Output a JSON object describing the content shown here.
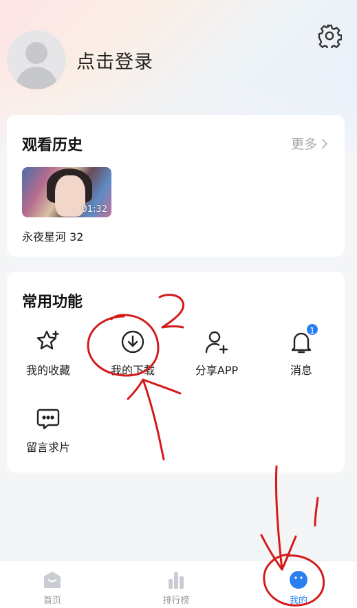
{
  "header": {
    "login_label": "点击登录"
  },
  "history": {
    "title": "观看历史",
    "more_label": "更多",
    "items": [
      {
        "caption": "永夜星河 32",
        "duration": "01:32"
      }
    ]
  },
  "functions": {
    "title": "常用功能",
    "items": [
      {
        "label": "我的收藏",
        "icon": "star-plus-icon"
      },
      {
        "label": "我的下载",
        "icon": "download-icon"
      },
      {
        "label": "分享APP",
        "icon": "user-plus-icon"
      },
      {
        "label": "消息",
        "icon": "bell-icon",
        "badge": "1"
      },
      {
        "label": "留言求片",
        "icon": "chat-bubble-icon"
      }
    ]
  },
  "tabbar": {
    "items": [
      {
        "label": "首页",
        "icon": "home-icon",
        "active": false
      },
      {
        "label": "排行榜",
        "icon": "ranking-icon",
        "active": false
      },
      {
        "label": "我的",
        "icon": "smiley-profile-icon",
        "active": true
      }
    ]
  },
  "colors": {
    "accent": "#2a7ff0",
    "annotation": "#d41a1a"
  }
}
